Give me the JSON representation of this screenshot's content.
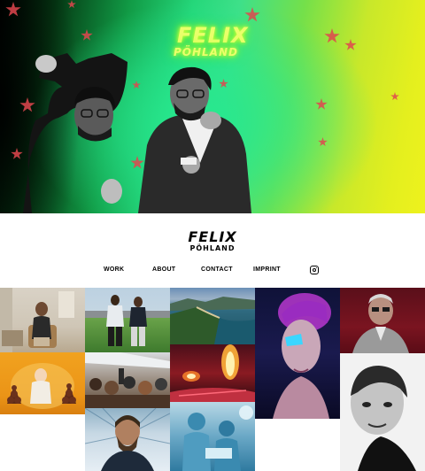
{
  "hero": {
    "neon_logo_line1": "FELIX",
    "neon_logo_line2": "PÖHLAND"
  },
  "logo": {
    "line1": "FELIX",
    "line2": "PÖHLAND"
  },
  "nav": {
    "items": [
      {
        "label": "WORK"
      },
      {
        "label": "ABOUT"
      },
      {
        "label": "CONTACT"
      },
      {
        "label": "IMPRINT"
      }
    ],
    "instagram_icon": "instagram-icon"
  },
  "gallery": {
    "tiles": [
      {
        "subject": "woman in chair"
      },
      {
        "subject": "two men on sports field"
      },
      {
        "subject": "aerial coastline"
      },
      {
        "subject": "woman with blue glitter makeup"
      },
      {
        "subject": "older man with glasses"
      },
      {
        "subject": "child with stacked pastries"
      },
      {
        "subject": "crowd at event"
      },
      {
        "subject": "fire performance"
      },
      {
        "subject": "bald man black and white"
      },
      {
        "subject": "bearded man portrait"
      },
      {
        "subject": "surgeons in operating room"
      }
    ]
  },
  "colors": {
    "hero_green": "#25d77a",
    "hero_yellow": "#eef21d",
    "star_red": "#e0474f",
    "neon": "#eaff6a"
  }
}
